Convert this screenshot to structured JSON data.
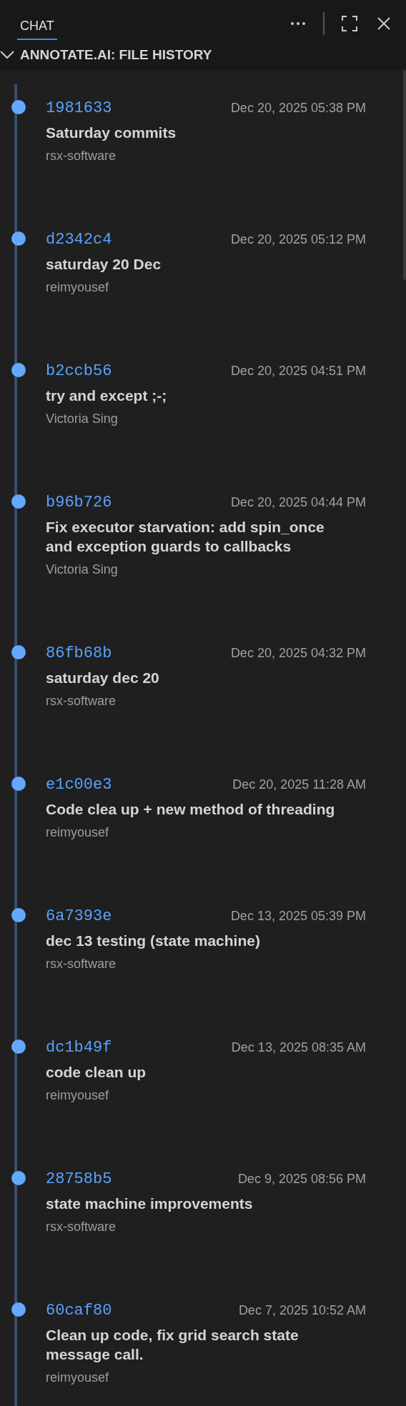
{
  "tabs": [
    {
      "label": "CHAT",
      "selected": true
    }
  ],
  "section": {
    "title": "ANNOTATE.AI: FILE HISTORY",
    "expanded": true
  },
  "commits": [
    {
      "hash": "1981633",
      "date": "Dec 20, 2025 05:38 PM",
      "message": "Saturday commits",
      "author": "rsx-software"
    },
    {
      "hash": "d2342c4",
      "date": "Dec 20, 2025 05:12 PM",
      "message": "saturday 20 Dec",
      "author": "reimyousef"
    },
    {
      "hash": "b2ccb56",
      "date": "Dec 20, 2025 04:51 PM",
      "message": "try and except ;-;",
      "author": "Victoria Sing"
    },
    {
      "hash": "b96b726",
      "date": "Dec 20, 2025 04:44 PM",
      "message": "Fix executor starvation: add spin_once and exception guards to callbacks",
      "author": "Victoria Sing"
    },
    {
      "hash": "86fb68b",
      "date": "Dec 20, 2025 04:32 PM",
      "message": "saturday dec 20",
      "author": "rsx-software"
    },
    {
      "hash": "e1c00e3",
      "date": "Dec 20, 2025 11:28 AM",
      "message": "Code clea up + new method of threading",
      "author": "reimyousef"
    },
    {
      "hash": "6a7393e",
      "date": "Dec 13, 2025 05:39 PM",
      "message": "dec 13 testing (state machine)",
      "author": "rsx-software"
    },
    {
      "hash": "dc1b49f",
      "date": "Dec 13, 2025 08:35 AM",
      "message": "code clean up",
      "author": "reimyousef"
    },
    {
      "hash": "28758b5",
      "date": "Dec 9, 2025 08:56 PM",
      "message": "state machine improvements",
      "author": "rsx-software"
    },
    {
      "hash": "60caf80",
      "date": "Dec 7, 2025 10:52 AM",
      "message": "Clean up code, fix grid search state message call.",
      "author": "reimyousef"
    }
  ]
}
